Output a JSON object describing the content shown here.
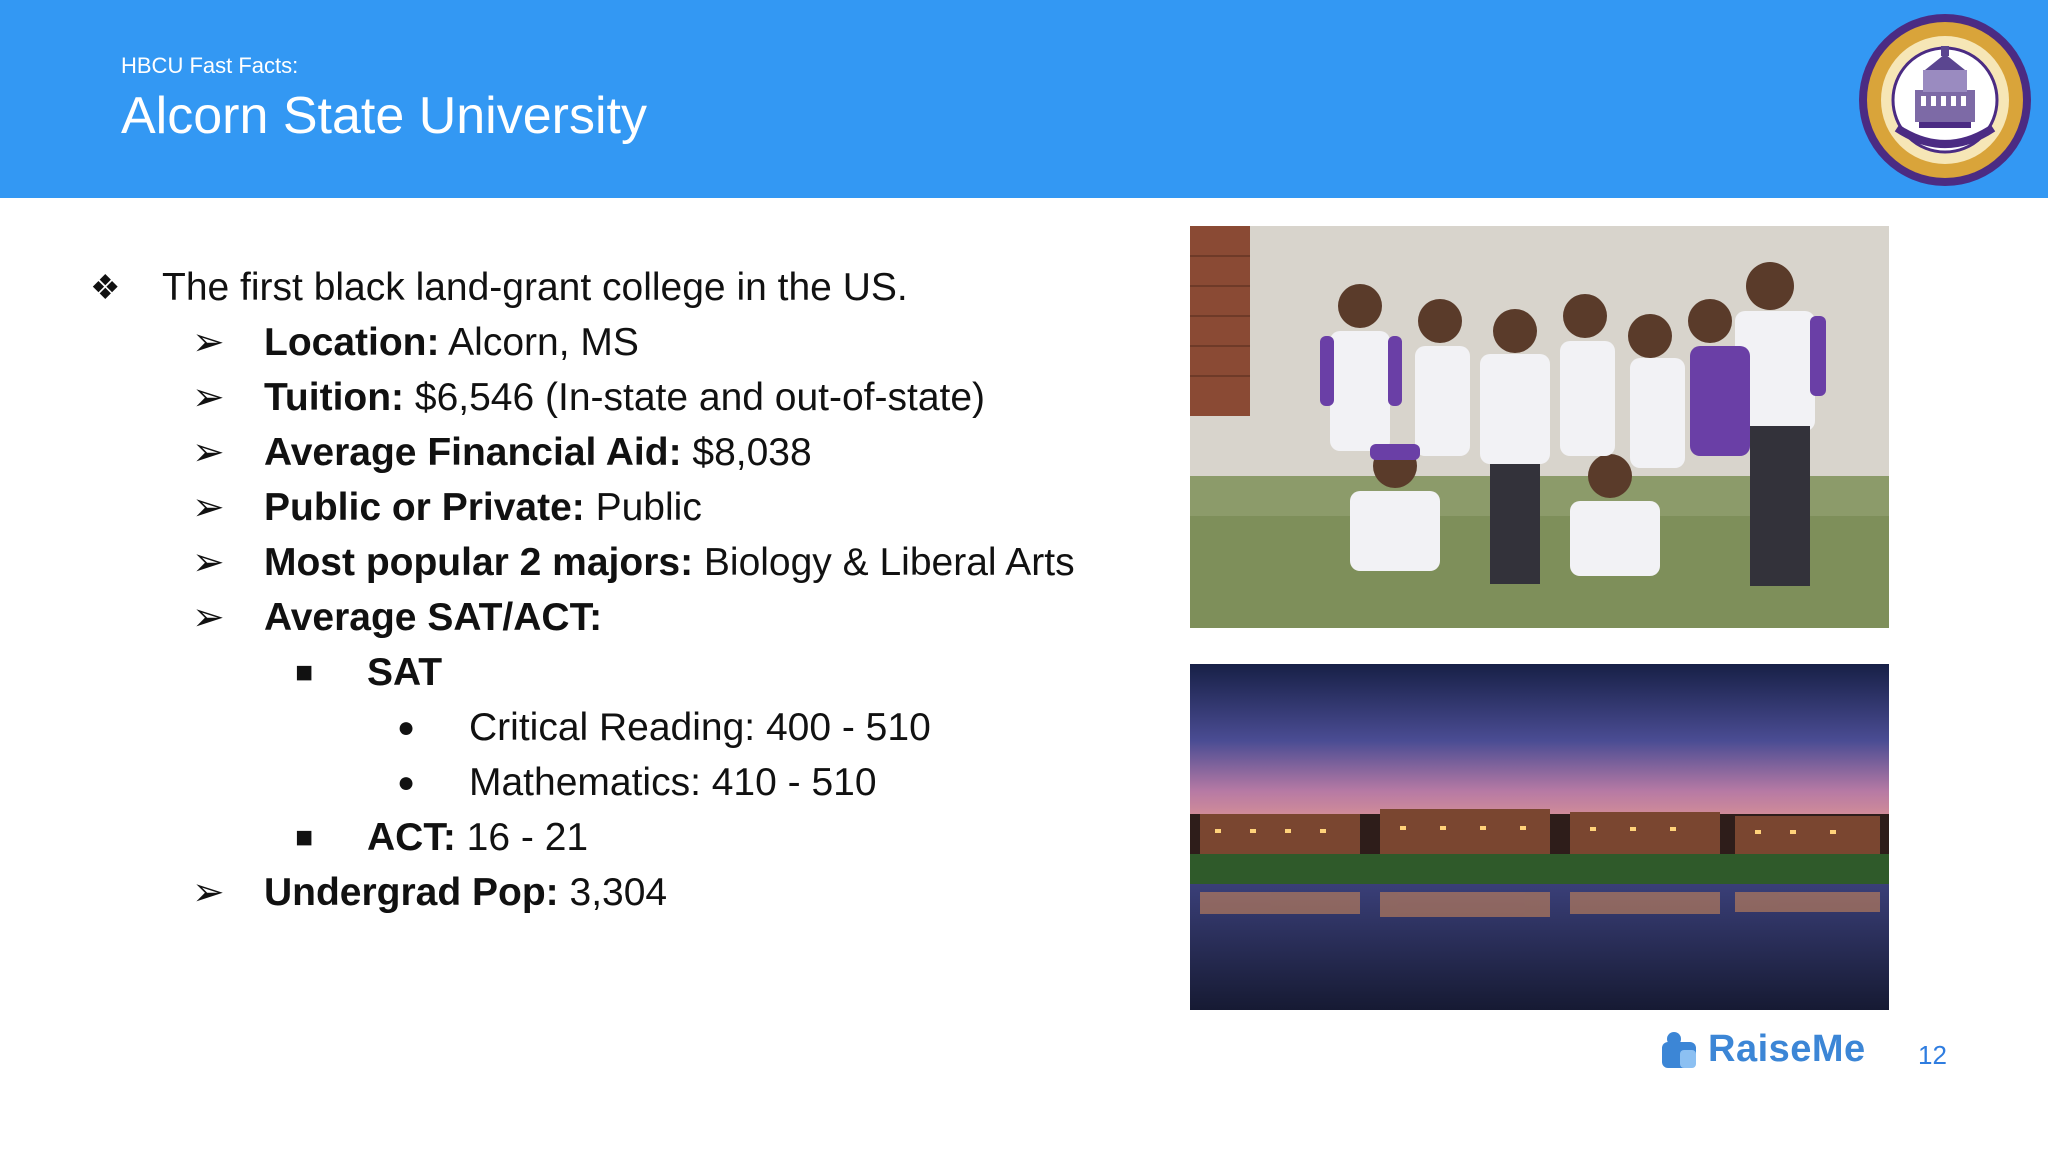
{
  "header": {
    "kicker": "HBCU Fast Facts:",
    "title": "Alcorn State University"
  },
  "seal": {
    "icon": "university-seal-icon",
    "colors": {
      "ring": "#4b2b83",
      "gold": "#e8b23a",
      "inner": "#ffffff"
    }
  },
  "facts": {
    "lead": "The first black land-grant college in the US.",
    "location_label": "Location:",
    "location_value": " Alcorn, MS",
    "tuition_label": "Tuition:",
    "tuition_value": " $6,546 (In-state and out-of-state)",
    "aid_label": "Average Financial Aid:",
    "aid_value": " $8,038",
    "public_label": "Public or Private:",
    "public_value": " Public",
    "majors_label": "Most popular 2 majors:",
    "majors_value": " Biology & Liberal Arts",
    "satact_label": "Average SAT/ACT:",
    "sat_label": "SAT",
    "sat_reading": "Critical Reading: 400 - 510",
    "sat_math": "Mathematics: 410 - 510",
    "act_label": "ACT:",
    "act_value": " 16 - 21",
    "undergrad_label": "Undergrad Pop:",
    "undergrad_value": " 3,304"
  },
  "bullets": {
    "diamond": "❖",
    "arrow": "➢",
    "square": "■",
    "dot": "●"
  },
  "photos": {
    "students": "students-group-photo",
    "campus": "campus-night-photo"
  },
  "brand": {
    "name": "RaiseMe",
    "icon": "raiseme-logo-icon",
    "color": "#3c86d6"
  },
  "page_number": "12"
}
